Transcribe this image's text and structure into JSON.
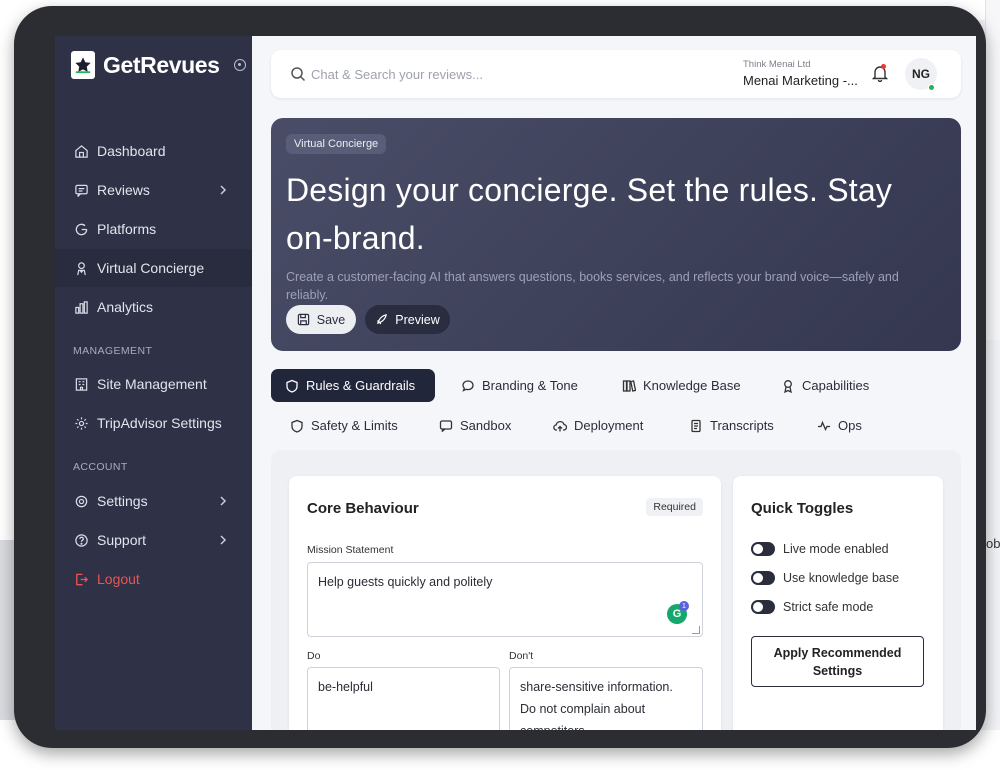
{
  "app": {
    "brand": "GetRevues"
  },
  "sidebar": {
    "items": [
      {
        "label": "Dashboard",
        "icon": "home-icon"
      },
      {
        "label": "Reviews",
        "icon": "message-icon",
        "has_submenu": true
      },
      {
        "label": "Platforms",
        "icon": "google-icon"
      },
      {
        "label": "Virtual Concierge",
        "icon": "concierge-icon",
        "active": true
      },
      {
        "label": "Analytics",
        "icon": "bar-chart-icon"
      }
    ],
    "management_heading": "MANAGEMENT",
    "management_items": [
      {
        "label": "Site Management",
        "icon": "building-icon"
      },
      {
        "label": "TripAdvisor Settings",
        "icon": "settings-icon"
      }
    ],
    "account_heading": "ACCOUNT",
    "account_items": [
      {
        "label": "Settings",
        "icon": "gear-icon",
        "has_submenu": true
      },
      {
        "label": "Support",
        "icon": "help-icon",
        "has_submenu": true
      },
      {
        "label": "Logout",
        "icon": "logout-icon",
        "color": "#ef5350"
      }
    ]
  },
  "topbar": {
    "search_placeholder": "Chat & Search your reviews...",
    "org_sub": "Think Menai Ltd",
    "org_main": "Menai Marketing -...",
    "avatar_initials": "NG"
  },
  "hero": {
    "badge": "Virtual Concierge",
    "title": "Design your concierge. Set the rules. Stay on-brand.",
    "description": "Create a customer-facing AI that answers questions, books services, and reflects your brand voice—safely and reliably.",
    "save_label": "Save",
    "preview_label": "Preview"
  },
  "tabs": [
    {
      "label": "Rules & Guardrails",
      "icon": "shield-icon",
      "active": true
    },
    {
      "label": "Branding & Tone",
      "icon": "chat-bubble-icon"
    },
    {
      "label": "Knowledge Base",
      "icon": "books-icon"
    },
    {
      "label": "Capabilities",
      "icon": "award-icon"
    },
    {
      "label": "Safety & Limits",
      "icon": "shield-outline-icon"
    },
    {
      "label": "Sandbox",
      "icon": "message-square-icon"
    },
    {
      "label": "Deployment",
      "icon": "cloud-upload-icon"
    },
    {
      "label": "Transcripts",
      "icon": "document-icon"
    },
    {
      "label": "Ops",
      "icon": "activity-icon"
    }
  ],
  "core_behaviour": {
    "title": "Core Behaviour",
    "required_badge": "Required",
    "mission_label": "Mission Statement",
    "mission_value": "Help guests quickly and politely",
    "grammar_count": "1",
    "do_label": "Do",
    "do_value": "be-helpful",
    "dont_label": "Don't",
    "dont_value": "share-sensitive information. Do not complain about competitors."
  },
  "quick_toggles": {
    "title": "Quick Toggles",
    "items": [
      {
        "label": "Live mode enabled",
        "on": true
      },
      {
        "label": "Use knowledge base",
        "on": true
      },
      {
        "label": "Strict safe mode",
        "on": true
      }
    ],
    "apply_label": "Apply Recommended Settings"
  },
  "background": {
    "right_edge_text": "ob"
  },
  "colors": {
    "sidebar": "#2f3147",
    "hero": "#3f4259",
    "active_tab": "#22263a",
    "logout": "#ef5350",
    "avatar_status": "#22b455"
  }
}
